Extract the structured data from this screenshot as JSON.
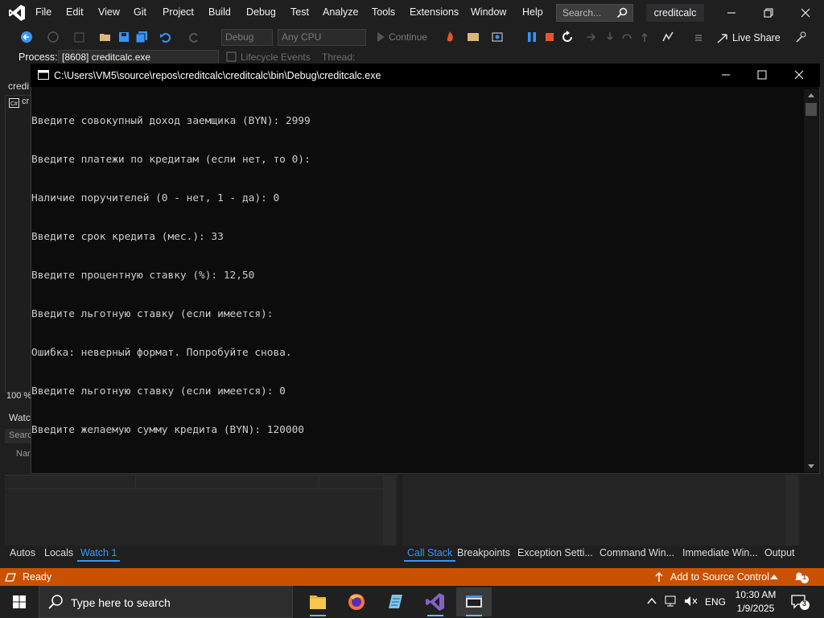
{
  "vs": {
    "menu": [
      "File",
      "Edit",
      "View",
      "Git",
      "Project",
      "Build",
      "Debug",
      "Test",
      "Analyze",
      "Tools",
      "Extensions",
      "Window",
      "Help"
    ],
    "search_placeholder": "Search...",
    "solution_name": "creditcalc",
    "toolbar": {
      "config_combo": "Debug",
      "platform_combo": "Any CPU",
      "continue_label": "Continue",
      "live_share_label": "Live Share"
    },
    "process_bar": {
      "label": "Process:",
      "process_value": "[8608] creditcalc.exe",
      "lifecycle_label": "Lifecycle Events",
      "thread_label": "Thread:"
    },
    "doc_tab": "credi",
    "editor_tab": "cr",
    "zoom": "100 %",
    "watch_title": "Watc",
    "watch_search": "Searc",
    "watch_name_column": "Nar",
    "left_panel_tabs": [
      "Autos",
      "Locals",
      "Watch 1"
    ],
    "left_active_tab": "Watch 1",
    "right_panel_tabs": [
      "Call Stack",
      "Breakpoints",
      "Exception Setti...",
      "Command Win...",
      "Immediate Win...",
      "Output"
    ],
    "right_active_tab": "Call Stack",
    "status": {
      "text": "Ready",
      "source_control": "Add to Source Control",
      "notification_count": "1"
    }
  },
  "console": {
    "title": "C:\\Users\\VM5\\source\\repos\\creditcalc\\creditcalc\\bin\\Debug\\creditcalc.exe",
    "lines": [
      "Введите совокупный доход заемщика (BYN): 2999",
      "Введите платежи по кредитам (если нет, то 0):",
      "Наличие поручителей (0 - нет, 1 - да): 0",
      "Введите срок кредита (мес.): 33",
      "Введите процентную ставку (%): 12,50",
      "Введите льготную ставку (если имеется):",
      "Ошибка: неверный формат. Попробуйте снова.",
      "Введите льготную ставку (если имеется): 0",
      "Введите желаемую сумму кредита (BYN): 120000"
    ]
  },
  "taskbar": {
    "search_placeholder": "Type here to search",
    "apps": [
      "file-explorer",
      "firefox",
      "notepad",
      "visual-studio",
      "console-host"
    ],
    "language": "ENG",
    "time": "10:30 AM",
    "date": "1/9/2025",
    "notification_count": "3"
  },
  "colors": {
    "status_bar": "#ca5100",
    "accent_blue": "#3794ff",
    "vs_purple": "#8661c5",
    "console_bg": "#0c0c0c"
  }
}
